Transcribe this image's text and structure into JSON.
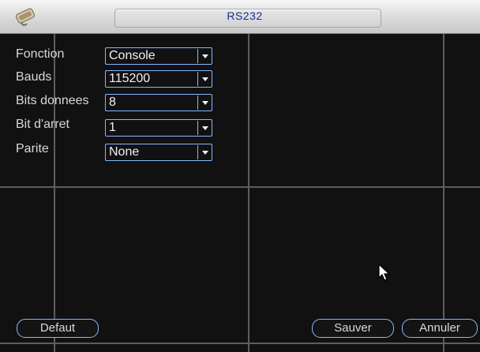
{
  "window": {
    "title": "RS232"
  },
  "form": {
    "fields": [
      {
        "label": "Fonction",
        "value": "Console"
      },
      {
        "label": "Bauds",
        "value": "115200"
      },
      {
        "label": "Bits donnees",
        "value": "8"
      },
      {
        "label": "Bit d'arret",
        "value": "1"
      },
      {
        "label": "Parite",
        "value": "None"
      }
    ]
  },
  "buttons": {
    "default_label": "Defaut",
    "save_label": "Sauver",
    "cancel_label": "Annuler"
  },
  "icons": {
    "title": "rs232-connector-icon",
    "dropdown": "chevron-down-icon",
    "cursor": "mouse-pointer-icon"
  },
  "colors": {
    "accent_border": "#86b8ff",
    "title_text": "#1c2c92",
    "label_text": "#d9d9d9",
    "background": "#111111"
  }
}
